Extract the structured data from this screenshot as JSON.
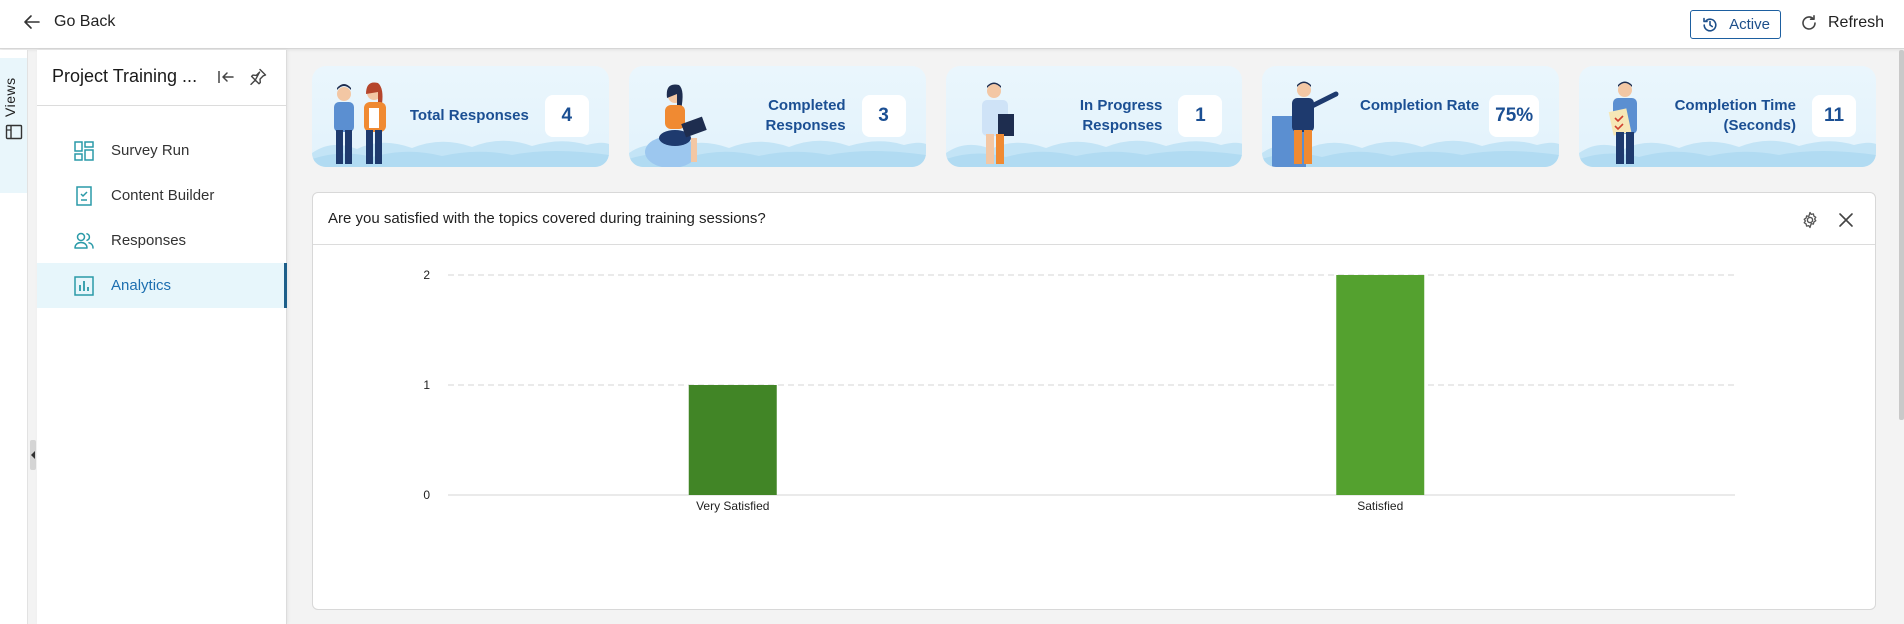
{
  "topbar": {
    "go_back_label": "Go Back",
    "status_label": "Active",
    "refresh_label": "Refresh"
  },
  "views_rail": {
    "label": "Views"
  },
  "sidebar": {
    "project_title": "Project Training ...",
    "items": [
      {
        "label": "Survey Run",
        "icon": "dashboard-icon",
        "active": false
      },
      {
        "label": "Content Builder",
        "icon": "checklist-icon",
        "active": false
      },
      {
        "label": "Responses",
        "icon": "users-icon",
        "active": false
      },
      {
        "label": "Analytics",
        "icon": "bar-chart-icon",
        "active": true
      }
    ]
  },
  "kpis": [
    {
      "label": "Total Responses",
      "value": "4"
    },
    {
      "label": "Completed Responses",
      "value": "3"
    },
    {
      "label": "In Progress Responses",
      "value": "1"
    },
    {
      "label": "Completion Rate",
      "value": "75%"
    },
    {
      "label": "Completion Time (Seconds)",
      "value": "11"
    }
  ],
  "panel": {
    "question": "Are you satisfied with the topics covered during training sessions?"
  },
  "colors": {
    "brand_blue": "#1b4f93",
    "bar_dark_green": "#418526",
    "bar_green": "#54a12f",
    "accent_teal": "#2a9aa8"
  },
  "chart_data": {
    "type": "bar",
    "categories": [
      "Very Satisfied",
      "Satisfied"
    ],
    "values": [
      1,
      2
    ],
    "ylim": [
      0,
      2
    ],
    "yticks": [
      0,
      1,
      2
    ],
    "grid": true,
    "bar_colors": [
      "#418526",
      "#54a12f"
    ]
  }
}
